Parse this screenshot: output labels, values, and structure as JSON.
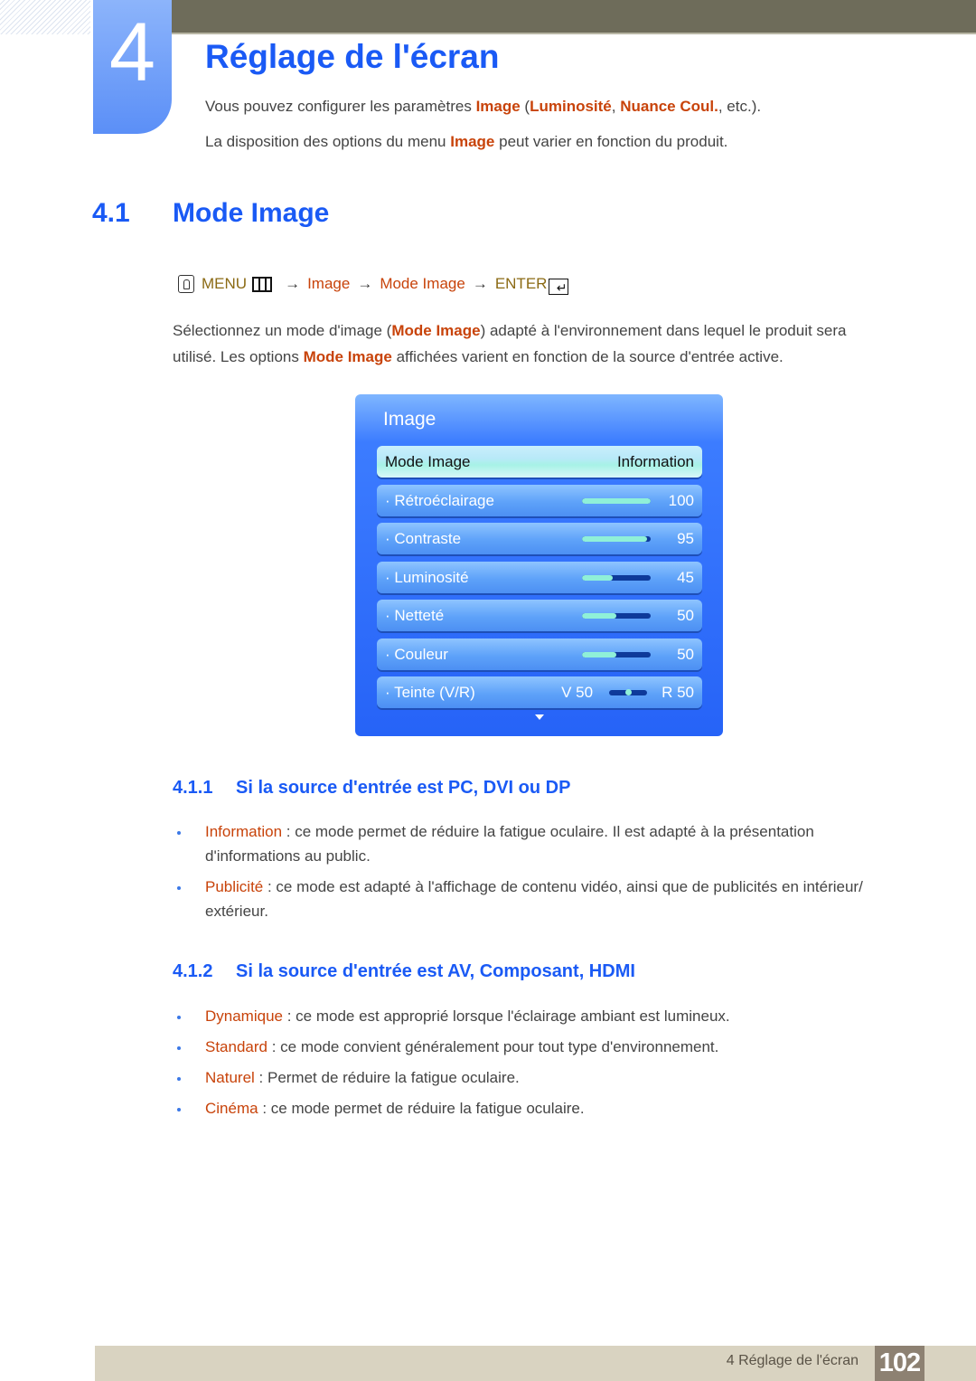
{
  "chapter": {
    "number": "4",
    "title": "Réglage de l'écran"
  },
  "intro": {
    "line1": {
      "pre": "Vous pouvez configurer les paramètres ",
      "term1": "Image",
      "open": " (",
      "term2": "Luminosité",
      "comma": ", ",
      "term3": "Nuance Coul.",
      "post": ", etc.)."
    },
    "line2": {
      "pre": "La disposition des options du menu ",
      "term": "Image",
      "post": " peut varier en fonction du produit."
    }
  },
  "section": {
    "number": "4.1",
    "title": "Mode Image"
  },
  "menu_path": {
    "icon": "hand-remote-icon",
    "menu_label": "MENU",
    "arrow": "→",
    "steps": [
      "Image",
      "Mode Image"
    ],
    "enter_label": "ENTER"
  },
  "paragraph": {
    "p1": "Sélectionnez un mode d'image (",
    "term1": "Mode Image",
    "p2": ") adapté à l'environnement dans lequel le produit sera utilisé. Les options ",
    "term2": "Mode Image",
    "p3": " affichées varient en fonction de la source d'entrée active."
  },
  "osd": {
    "title": "Image",
    "mode_row": {
      "label": "Mode Image",
      "value": "Information"
    },
    "rows": [
      {
        "label": "· Rétroéclairage",
        "value": "100",
        "level": 100
      },
      {
        "label": "· Contraste",
        "value": "95",
        "level": 95
      },
      {
        "label": "· Luminosité",
        "value": "45",
        "level": 45
      },
      {
        "label": "· Netteté",
        "value": "50",
        "level": 50
      },
      {
        "label": "· Couleur",
        "value": "50",
        "level": 50
      }
    ],
    "tint": {
      "label": "· Teinte (V/R)",
      "left": "V 50",
      "right": "R 50",
      "level": 50
    },
    "more_icon": "down-arrow-icon"
  },
  "subsections": [
    {
      "number": "4.1.1",
      "title": "Si la source d'entrée est PC, DVI ou DP",
      "items": [
        {
          "term": "Information",
          "text": " : ce mode permet de réduire la fatigue oculaire. Il est adapté à la présentation d'informations au public."
        },
        {
          "term": "Publicité",
          "text": " : ce mode est adapté à l'affichage de contenu vidéo, ainsi que de publicités en intérieur/ extérieur."
        }
      ]
    },
    {
      "number": "4.1.2",
      "title": "Si la source d'entrée est AV, Composant, HDMI",
      "items": [
        {
          "term": "Dynamique",
          "text": " : ce mode est approprié lorsque l'éclairage ambiant est lumineux."
        },
        {
          "term": "Standard",
          "text": " : ce mode convient généralement pour tout type d'environnement."
        },
        {
          "term": "Naturel",
          "text": " : Permet de réduire la fatigue oculaire."
        },
        {
          "term": "Cinéma",
          "text": " : ce mode permet de réduire la fatigue oculaire."
        }
      ]
    }
  ],
  "footer": {
    "chapter_label": "4 Réglage de l'écran",
    "page_number": "102"
  },
  "colors": {
    "heading_blue": "#1a5af5",
    "term_orange": "#c8430a",
    "menu_gold": "#8b6a14",
    "top_bar": "#6e6c5a",
    "footer_bg": "#d9d3c1",
    "page_num_bg": "#8d8172"
  }
}
